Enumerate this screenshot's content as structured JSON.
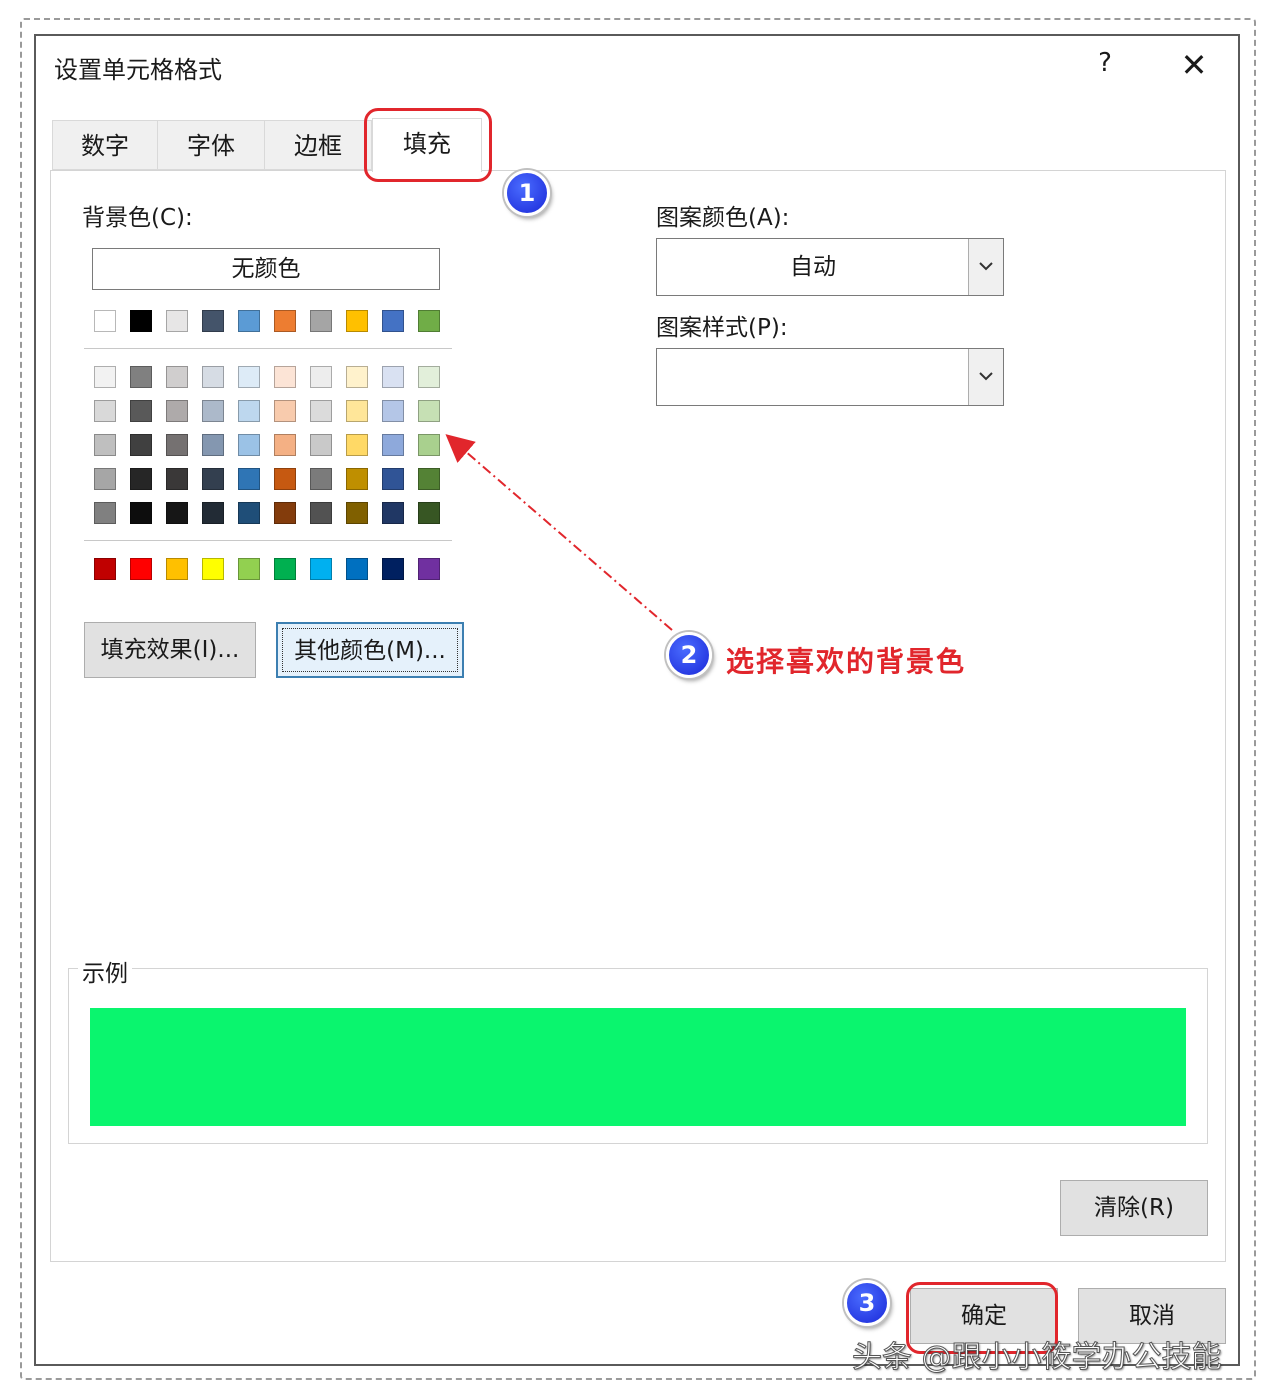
{
  "dialog": {
    "title": "设置单元格格式",
    "help": "?",
    "close": "✕"
  },
  "tabs": [
    {
      "label": "数字"
    },
    {
      "label": "字体"
    },
    {
      "label": "边框"
    },
    {
      "label": "填充",
      "active": true
    }
  ],
  "fill": {
    "bg_label": "背景色(C):",
    "no_color": "无颜色",
    "theme_top": [
      "#ffffff",
      "#000000",
      "#e7e6e6",
      "#44546a",
      "#5b9bd5",
      "#ed7d31",
      "#a5a5a5",
      "#ffc000",
      "#4472c4",
      "#70ad47"
    ],
    "theme_shades": [
      [
        "#f2f2f2",
        "#808080",
        "#d0cece",
        "#d6dce4",
        "#ddebf7",
        "#fce4d6",
        "#ededed",
        "#fff2cc",
        "#d9e1f2",
        "#e2efda"
      ],
      [
        "#d9d9d9",
        "#595959",
        "#aeaaaa",
        "#acb9ca",
        "#bdd7ee",
        "#f8cbad",
        "#dbdbdb",
        "#ffe699",
        "#b4c6e7",
        "#c6e0b4"
      ],
      [
        "#bfbfbf",
        "#404040",
        "#757171",
        "#8497b0",
        "#9bc2e6",
        "#f4b084",
        "#c9c9c9",
        "#ffd966",
        "#8ea9db",
        "#a9d08e"
      ],
      [
        "#a6a6a6",
        "#262626",
        "#3a3838",
        "#333f4f",
        "#2f75b5",
        "#c65911",
        "#7b7b7b",
        "#bf8f00",
        "#305496",
        "#548235"
      ],
      [
        "#808080",
        "#0d0d0d",
        "#161616",
        "#222b35",
        "#1f4e78",
        "#833c0c",
        "#525252",
        "#806000",
        "#203764",
        "#375623"
      ]
    ],
    "standard": [
      "#c00000",
      "#ff0000",
      "#ffc000",
      "#ffff00",
      "#92d050",
      "#00b050",
      "#00b0f0",
      "#0070c0",
      "#002060",
      "#7030a0"
    ],
    "fill_effects": "填充效果(I)...",
    "more_colors": "其他颜色(M)...",
    "pattern_color_label": "图案颜色(A):",
    "pattern_color_value": "自动",
    "pattern_style_label": "图案样式(P):",
    "pattern_style_value": "",
    "sample_label": "示例",
    "sample_color": "#0af56e",
    "clear": "清除(R)"
  },
  "footer": {
    "ok": "确定",
    "cancel": "取消"
  },
  "annotations": {
    "step1": "1",
    "step2": "2",
    "step2_text": "选择喜欢的背景色",
    "step3": "3",
    "highlight_color": "#e1262c",
    "badge_color": "#1a28d8"
  },
  "watermark": "头条 @跟小小筱学办公技能"
}
